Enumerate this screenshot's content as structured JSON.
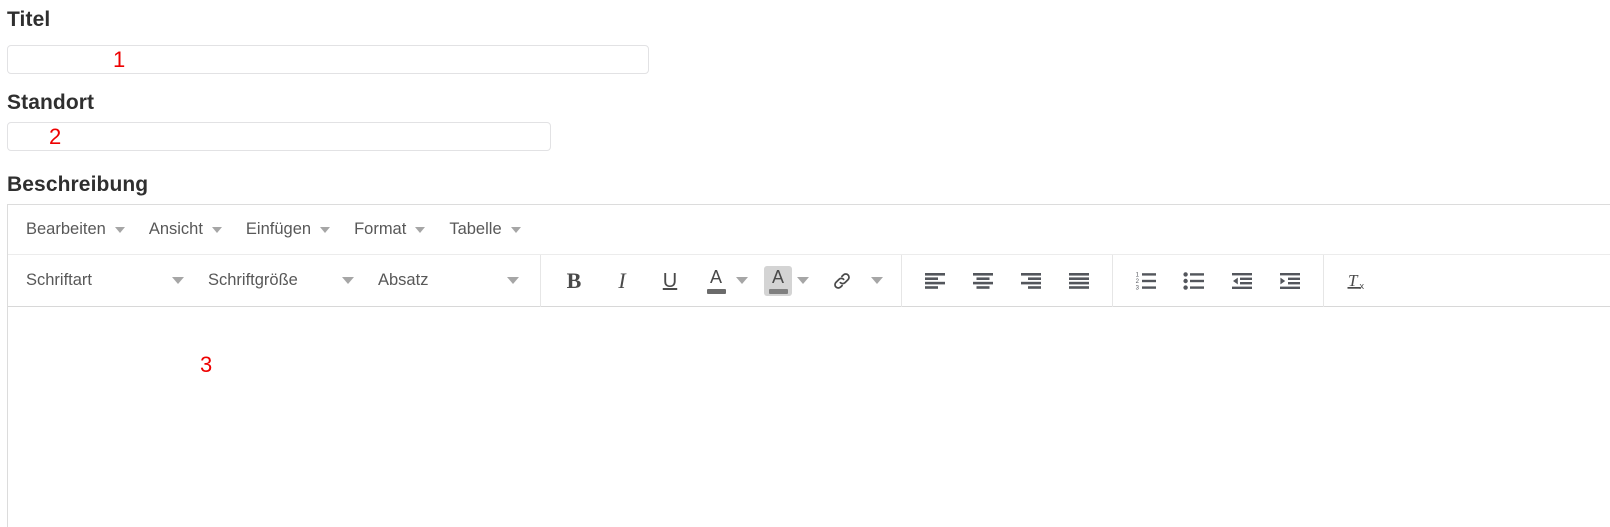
{
  "form": {
    "fields": [
      {
        "label": "Titel",
        "value": "",
        "placeholder": "",
        "annotation": "1"
      },
      {
        "label": "Standort",
        "value": "",
        "placeholder": "",
        "annotation": "2"
      },
      {
        "label": "Beschreibung",
        "annotation": "3"
      }
    ]
  },
  "editor": {
    "menubar": [
      {
        "label": "Bearbeiten",
        "icon": "chevron-down-icon"
      },
      {
        "label": "Ansicht",
        "icon": "chevron-down-icon"
      },
      {
        "label": "Einfügen",
        "icon": "chevron-down-icon"
      },
      {
        "label": "Format",
        "icon": "chevron-down-icon"
      },
      {
        "label": "Tabelle",
        "icon": "chevron-down-icon"
      }
    ],
    "toolbar": {
      "font_family": {
        "label": "Schriftart",
        "icon": "chevron-down-icon"
      },
      "font_size": {
        "label": "Schriftgröße",
        "icon": "chevron-down-icon"
      },
      "paragraph": {
        "label": "Absatz",
        "icon": "chevron-down-icon"
      },
      "bold": {
        "glyph": "B",
        "icon": "bold-icon"
      },
      "italic": {
        "glyph": "I",
        "icon": "italic-icon"
      },
      "underline": {
        "glyph": "U",
        "icon": "underline-icon"
      },
      "text_color": {
        "glyph": "A",
        "icon": "text-color-icon",
        "swatch": "#6b6b6b"
      },
      "background_color": {
        "glyph": "A",
        "icon": "background-color-icon",
        "swatch": "#808080"
      },
      "link": {
        "icon": "link-icon"
      },
      "align_left": {
        "icon": "align-left-icon"
      },
      "align_center": {
        "icon": "align-center-icon"
      },
      "align_right": {
        "icon": "align-right-icon"
      },
      "align_justify": {
        "icon": "align-justify-icon"
      },
      "numbered_list": {
        "icon": "numbered-list-icon"
      },
      "bulleted_list": {
        "icon": "bulleted-list-icon"
      },
      "outdent": {
        "icon": "decrease-indent-icon"
      },
      "indent": {
        "icon": "increase-indent-icon"
      },
      "clear_formatting": {
        "glyph": "T",
        "subscript": "x",
        "icon": "clear-formatting-icon"
      }
    },
    "content": ""
  },
  "colors": {
    "annotation": "#ee0000",
    "label": "#2f2f2f",
    "menu_text": "#585858",
    "icon": "#4a4a4a",
    "border": "#dcdcdc",
    "input_border": "#e2e2e4"
  }
}
